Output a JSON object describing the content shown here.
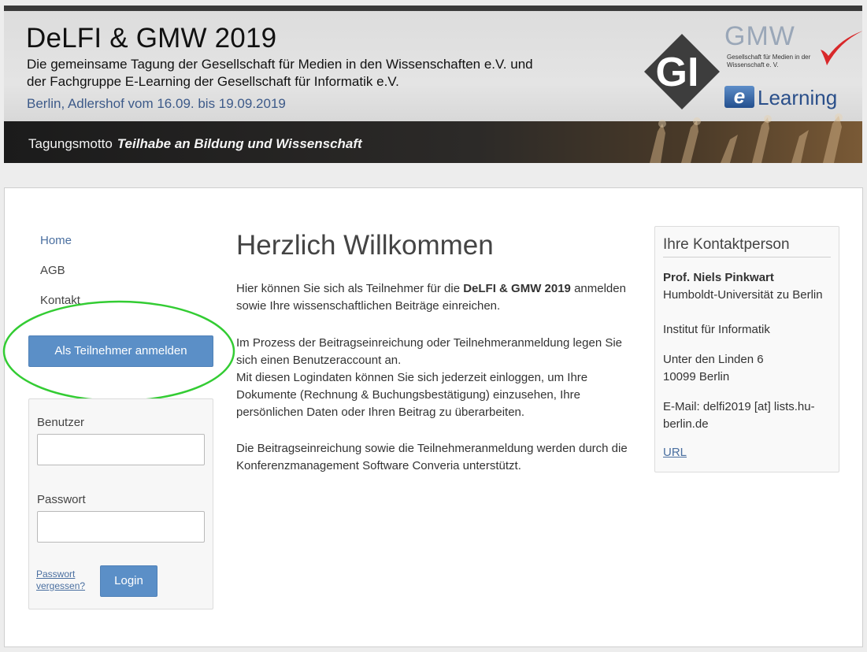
{
  "banner": {
    "title": "DeLFI & GMW 2019",
    "subtitle_line1": "Die gemeinsame Tagung der Gesellschaft für Medien in den Wissenschaften e.V. und",
    "subtitle_line2": "der Fachgruppe E-Learning der Gesellschaft für Informatik e.V.",
    "location": "Berlin, Adlershof  vom 16.09. bis 19.09.2019",
    "motto_label": "Tagungsmotto",
    "motto": "Teilhabe an Bildung und Wissenschaft",
    "logos": {
      "gi": "GI",
      "gmw": "GMW",
      "gmw_sub": "Gesellschaft für Medien in der Wissenschaft e. V.",
      "elearning_e": "e",
      "elearning": "Learning"
    }
  },
  "nav": {
    "home": "Home",
    "agb": "AGB",
    "kontakt": "Kontakt",
    "register_button": "Als Teilnehmer anmelden"
  },
  "login": {
    "user_label": "Benutzer",
    "password_label": "Passwort",
    "user_value": "",
    "password_value": "",
    "forgot": "Passwort vergessen?",
    "login_button": "Login"
  },
  "main": {
    "heading": "Herzlich Willkommen",
    "p1_pre": "Hier können Sie sich als Teilnehmer für die ",
    "p1_bold": "DeLFI & GMW 2019",
    "p1_post": " anmelden sowie Ihre wissenschaftlichen Beiträge einreichen.",
    "p2": "Im Prozess der Beitragseinreichung oder Teilnehmeranmeldung legen Sie sich einen Benutzeraccount an.",
    "p3": "Mit diesen Logindaten können Sie sich jederzeit einloggen, um Ihre Dokumente (Rechnung & Buchungsbestätigung) einzusehen, Ihre persönlichen Daten oder Ihren Beitrag zu überarbeiten.",
    "p4": "Die Beitragseinreichung sowie die Teilnehmeranmeldung werden durch die Konferenzmanagement Software Converia unterstützt."
  },
  "contact": {
    "heading": "Ihre Kontaktperson",
    "name": "Prof. Niels Pinkwart",
    "org": "Humboldt-Universität zu Berlin",
    "dept": "Institut für Informatik",
    "street": "Unter den Linden 6",
    "city": "10099 Berlin",
    "email": "E-Mail: delfi2019 [at] lists.hu-berlin.de",
    "url": "URL"
  },
  "colors": {
    "accent": "#5b8fc7",
    "link": "#4a6fa0",
    "highlight": "#33cc33"
  }
}
